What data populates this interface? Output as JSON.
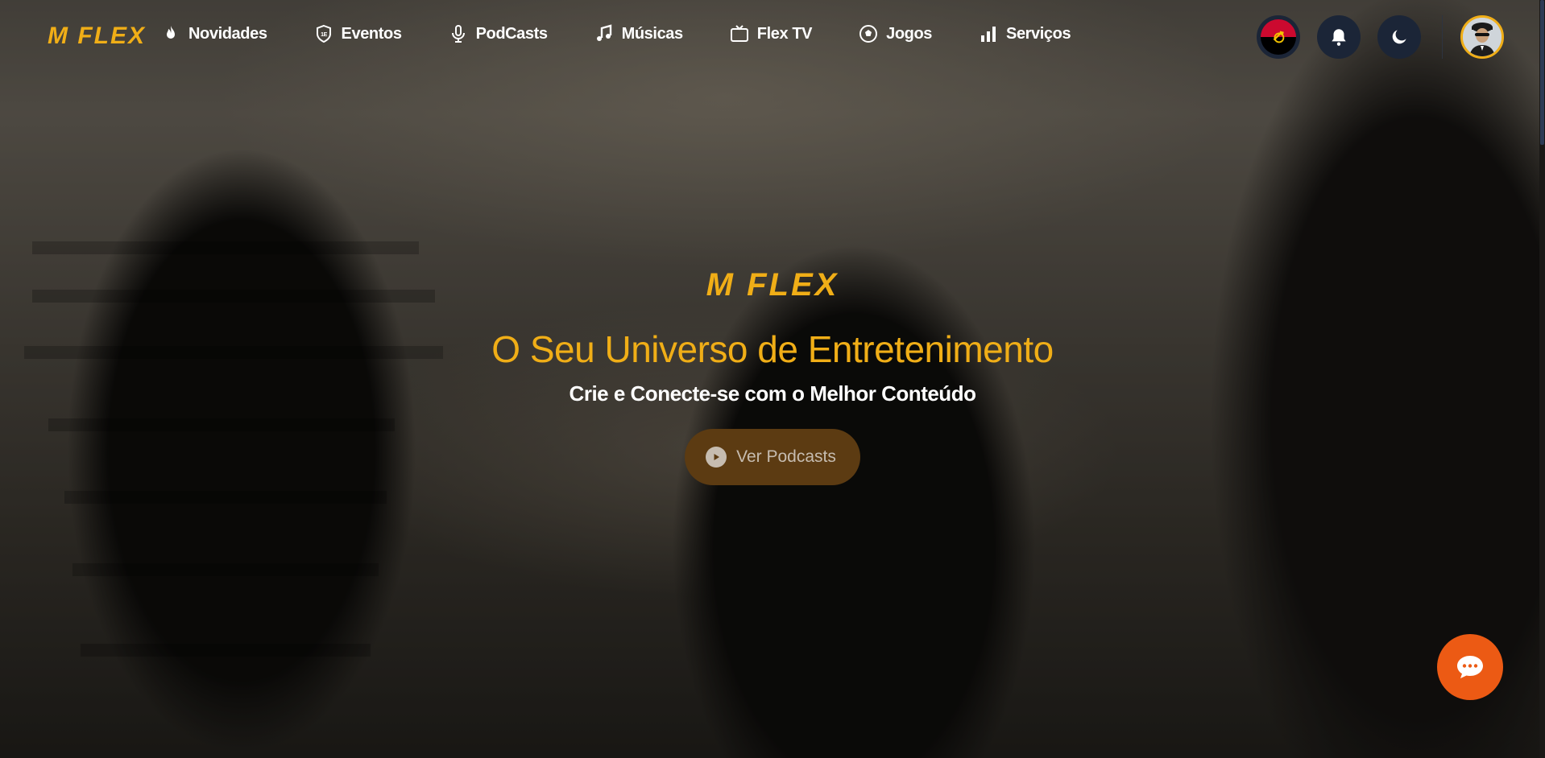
{
  "brand": {
    "logo_text": "M FLEX"
  },
  "nav": {
    "items": [
      {
        "label": "Novidades",
        "icon": "flame-icon"
      },
      {
        "label": "Eventos",
        "icon": "badge-icon"
      },
      {
        "label": "PodCasts",
        "icon": "microphone-icon"
      },
      {
        "label": "Músicas",
        "icon": "music-note-icon"
      },
      {
        "label": "Flex TV",
        "icon": "tv-icon"
      },
      {
        "label": "Jogos",
        "icon": "soccer-ball-icon"
      },
      {
        "label": "Serviços",
        "icon": "bar-chart-icon"
      }
    ]
  },
  "header_actions": {
    "language_flag": "angola-flag-icon",
    "notifications": "bell-icon",
    "theme_toggle": "moon-icon",
    "profile": "user-avatar"
  },
  "hero": {
    "logo_text": "M FLEX",
    "title": "O Seu Universo de Entretenimento",
    "subtitle": "Crie e Conecte-se com o Melhor Conteúdo",
    "cta_label": "Ver Podcasts",
    "cta_icon": "play-circle-icon"
  },
  "chat": {
    "icon": "chat-bubble-icon"
  },
  "colors": {
    "accent": "#f0ae17",
    "cta_bg": "#5c3b12",
    "chat_fab": "#ec5a14",
    "icon_button_bg": "#1b2537"
  }
}
